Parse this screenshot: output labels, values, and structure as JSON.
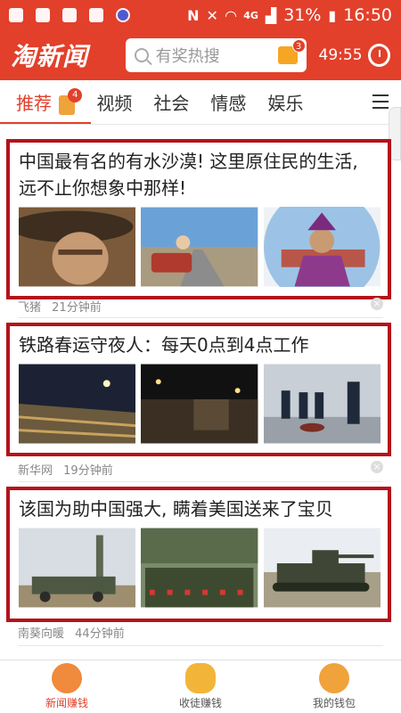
{
  "status_bar": {
    "network": "4G",
    "battery": "31%",
    "time": "16:50"
  },
  "header": {
    "logo": "淘新闻",
    "search_placeholder": "有奖热搜",
    "gift_count": "3",
    "countdown": "49:55"
  },
  "tabs": [
    {
      "label": "推荐",
      "badge": "4"
    },
    {
      "label": "视频"
    },
    {
      "label": "社会"
    },
    {
      "label": "情感"
    },
    {
      "label": "娱乐"
    }
  ],
  "articles": [
    {
      "title": "中国最有名的有水沙漠! 这里原住民的生活, 远不止你想象中那样!",
      "source": "飞猪",
      "time": "21分钟前"
    },
    {
      "title": "铁路春运守夜人：每天0点到4点工作",
      "source": "新华网",
      "time": "19分钟前"
    },
    {
      "title": "该国为助中国强大, 瞒着美国送来了宝贝",
      "source": "南葵向暖",
      "time": "44分钟前"
    }
  ],
  "bottom_nav": [
    {
      "label": "新闻赚钱"
    },
    {
      "label": "收徒赚钱"
    },
    {
      "label": "我的钱包"
    }
  ],
  "colors": {
    "brand": "#e2402b",
    "highlight_border": "#b5121b"
  }
}
